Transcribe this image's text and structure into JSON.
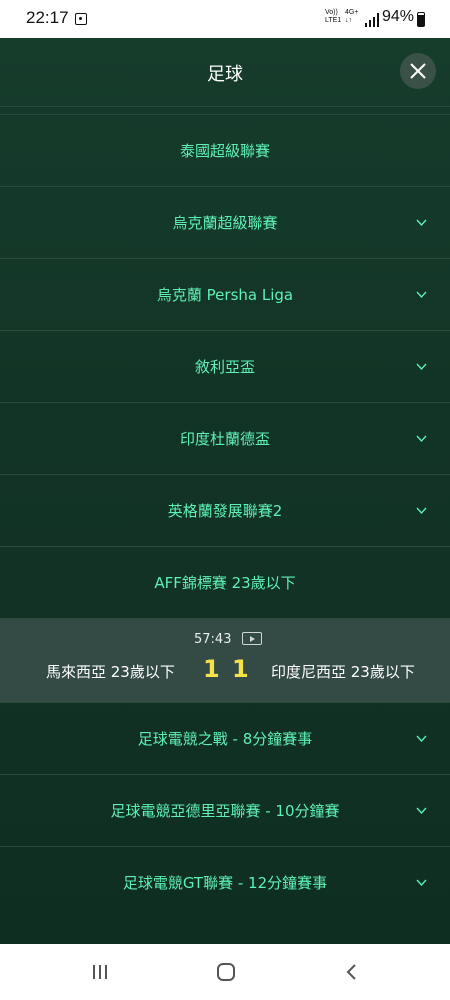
{
  "status_bar": {
    "time": "22:17",
    "network_top": "Vo))",
    "network_bottom": "LTE1",
    "network2_top": "4G+",
    "network2_bottom": "↓↑",
    "battery": "94%"
  },
  "header": {
    "title": "足球",
    "close_icon": "close-icon"
  },
  "competitions": [
    {
      "label": "泰國超級聯賽",
      "expandable": false
    },
    {
      "label": "烏克蘭超級聯賽",
      "expandable": true
    },
    {
      "label": "烏克蘭 Persha Liga",
      "expandable": true
    },
    {
      "label": "敘利亞盃",
      "expandable": true
    },
    {
      "label": "印度杜蘭德盃",
      "expandable": true
    },
    {
      "label": "英格蘭發展聯賽2",
      "expandable": true
    },
    {
      "label": "AFF錦標賽 23歲以下",
      "expandable": false
    }
  ],
  "live_match": {
    "clock": "57:43",
    "home_team": "馬來西亞 23歲以下",
    "away_team": "印度尼西亞 23歲以下",
    "home_score": "1",
    "away_score": "1"
  },
  "competitions_after": [
    {
      "label": "足球電競之戰 - 8分鐘賽事",
      "expandable": true
    },
    {
      "label": "足球電競亞德里亞聯賽 - 10分鐘賽",
      "expandable": true
    },
    {
      "label": "足球電競GT聯賽 - 12分鐘賽事",
      "expandable": true
    }
  ],
  "colors": {
    "accent": "#5ff0b5",
    "score": "#f5e14a",
    "background": "#123426"
  }
}
